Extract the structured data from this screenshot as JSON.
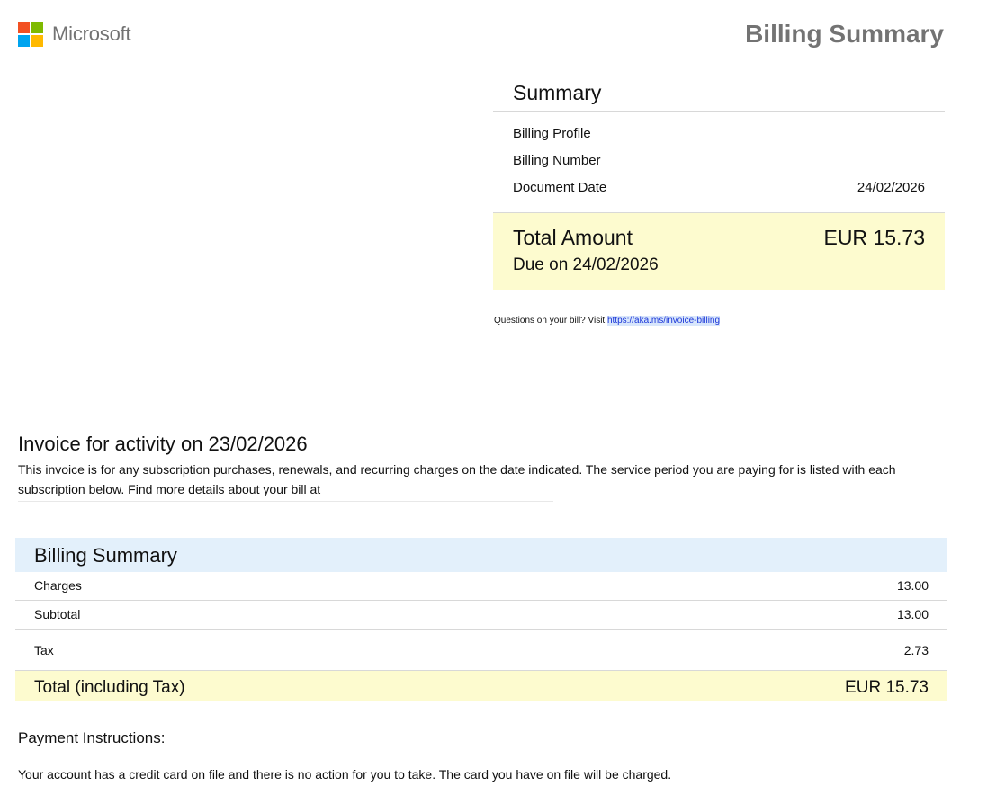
{
  "header": {
    "brand": "Microsoft",
    "doc_title": "Billing Summary"
  },
  "summary": {
    "heading": "Summary",
    "rows": [
      {
        "label": "Billing Profile",
        "value": ""
      },
      {
        "label": "Billing Number",
        "value": ""
      },
      {
        "label": "Document Date",
        "value": "24/02/2026"
      }
    ],
    "total_label": "Total Amount",
    "total_value": "EUR 15.73",
    "due_text": "Due on 24/02/2026",
    "questions_text": "Questions on your bill? Visit",
    "questions_link": "https://aka.ms/invoice-billing"
  },
  "invoice": {
    "heading": "Invoice for activity on 23/02/2026",
    "description": "This invoice is for any subscription purchases, renewals, and recurring charges on the date indicated. The service period you are paying for is listed with each subscription below. Find more details about your bill at"
  },
  "billing": {
    "heading": "Billing Summary",
    "rows": [
      {
        "label": "Charges",
        "value": "13.00"
      },
      {
        "label": "Subtotal",
        "value": "13.00"
      },
      {
        "label": "Tax",
        "value": "2.73"
      }
    ],
    "total_label": "Total (including Tax)",
    "total_value": "EUR 15.73"
  },
  "payment": {
    "heading": "Payment Instructions:",
    "text": "Your account has a credit card on file and there is no action for you to take. The card you have on file will be charged."
  },
  "colors": {
    "total_highlight": "#fdfbcf",
    "billing_header": "#e3f0fb",
    "link": "#1a35d8",
    "logo_red": "#f25022",
    "logo_green": "#7fba00",
    "logo_blue": "#00a4ef",
    "logo_yellow": "#ffb900"
  }
}
